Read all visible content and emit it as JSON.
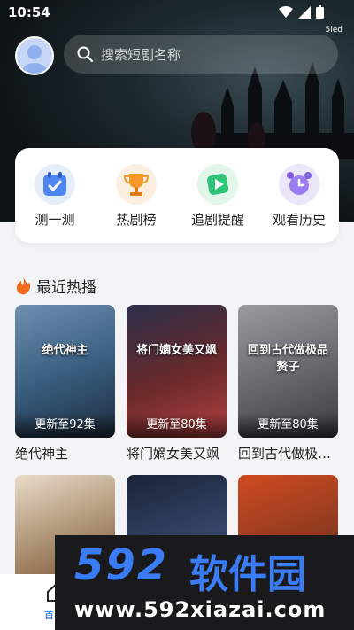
{
  "status_bar": {
    "time": "10:54",
    "network": "5led"
  },
  "search": {
    "placeholder": "搜索短剧名称"
  },
  "quick_actions": [
    {
      "label": "测一测",
      "icon": "quiz-badge-icon"
    },
    {
      "label": "热剧榜",
      "icon": "trophy-icon"
    },
    {
      "label": "追剧提醒",
      "icon": "play-card-icon"
    },
    {
      "label": "观看历史",
      "icon": "alarm-clock-icon"
    }
  ],
  "section": {
    "title": "最近热播"
  },
  "dramas": [
    {
      "title": "绝代神主",
      "poster_text": "绝代神主",
      "update": "更新至92集",
      "color": "#3a5f80"
    },
    {
      "title": "将门嫡女美又飒",
      "poster_text": "将门嫡女美又飒",
      "update": "更新至80集",
      "color": "#6b2a2a"
    },
    {
      "title": "回到古代做极…",
      "poster_text": "回到古代做极品赘子",
      "update": "更新至80集",
      "color": "#6a6a70"
    },
    {
      "title": "",
      "poster_text": "",
      "update": "",
      "color": "#7a5a40"
    },
    {
      "title": "",
      "poster_text": "",
      "update": "",
      "color": "#2a3a55"
    },
    {
      "title": "",
      "poster_text": "",
      "update": "",
      "color": "#8a3a20"
    }
  ],
  "bottom_nav": {
    "home_label": "首"
  },
  "watermark": {
    "brand": "592",
    "brand_cn": "软件园",
    "url": "www.592xiazai.com"
  }
}
